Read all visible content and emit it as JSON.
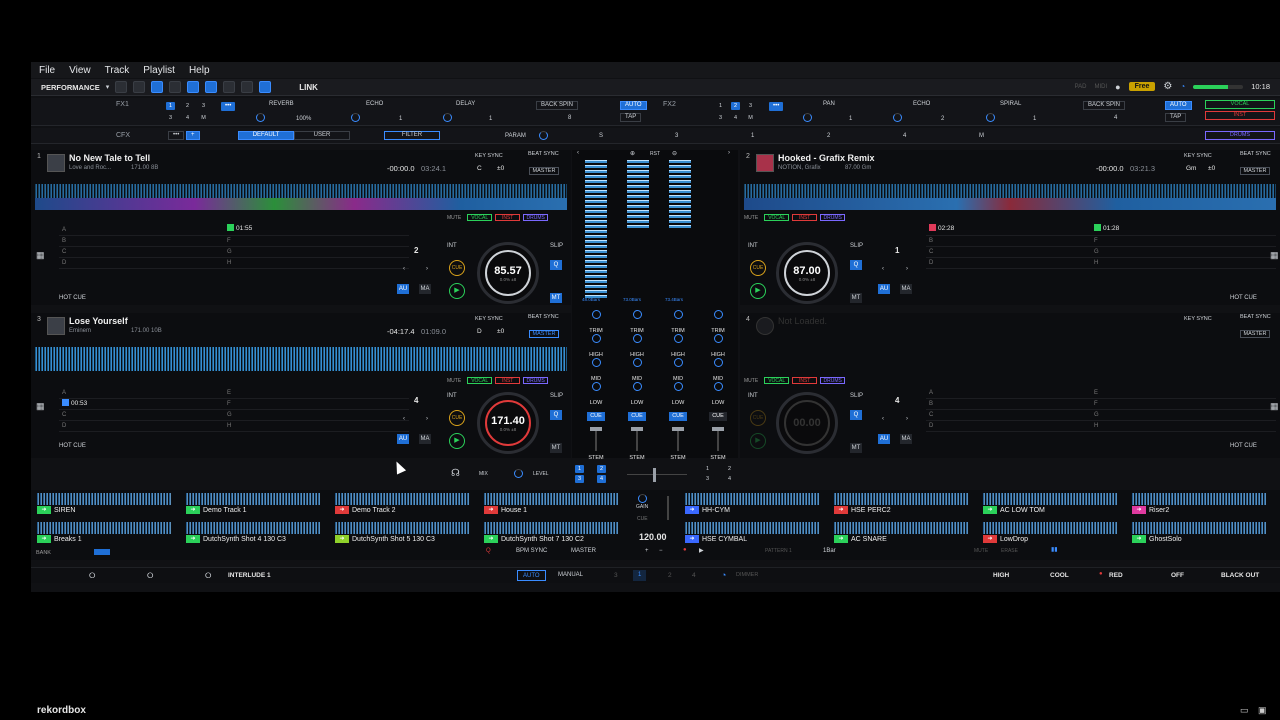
{
  "menu": [
    "File",
    "View",
    "Track",
    "Playlist",
    "Help"
  ],
  "toolbar": {
    "mode": "PERFORMANCE",
    "link": "LINK",
    "pad": "PAD",
    "midi": "MIDI",
    "plan": "Free",
    "clock": "10:18"
  },
  "fx1": {
    "label": "FX1",
    "slots": [
      "REVERB",
      "ECHO",
      "DELAY"
    ],
    "beat": "BACK SPIN",
    "auto": "AUTO",
    "tap": "TAP",
    "pct": "100%",
    "n1": "1",
    "n2": "1",
    "n3": "8"
  },
  "fx2": {
    "label": "FX2",
    "slots": [
      "PAN",
      "ECHO",
      "SPIRAL"
    ],
    "beat": "BACK SPIN",
    "auto": "AUTO",
    "tap": "TAP",
    "n1": "1",
    "n2": "2",
    "n3": "1",
    "n4": "4"
  },
  "fx_channels": [
    "1",
    "2",
    "3",
    "4",
    "M"
  ],
  "cfx": {
    "label": "CFX",
    "default": "DEFAULT",
    "user": "USER",
    "filter": "FILTER",
    "param": "PARAM",
    "s": "S",
    "nums": [
      "3",
      "1",
      "2",
      "4",
      "M"
    ]
  },
  "stem_colors": {
    "vocal": "VOCAL",
    "inst": "INST",
    "drums": "DRUMS"
  },
  "deck_labels": {
    "key_sync": "KEY SYNC",
    "beat_sync": "BEAT SYNC",
    "master": "MASTER",
    "mute": "MUTE",
    "vocal": "VOCAL",
    "inst": "INST",
    "drums": "DRUMS",
    "int": "INT",
    "slip": "SLIP",
    "q": "Q",
    "au": "AU",
    "ma": "MA",
    "mt": "MT",
    "cue": "CUE",
    "hot_cue": "HOT CUE"
  },
  "cue_letters_left": [
    "A",
    "B",
    "C",
    "D"
  ],
  "cue_letters_right": [
    "E",
    "F",
    "G",
    "H"
  ],
  "deck1": {
    "num": "1",
    "title": "No New Tale to Tell",
    "artist": "Love and Roc...",
    "bpm_key": "171.00  8B",
    "elapsed": "-00:00.0",
    "remain": "03:24.1",
    "key": "C",
    "pitch": "±0",
    "bpm": "85.57",
    "bpm_sub": "0.0%  ±8",
    "loop": "2",
    "cue1": "01:55"
  },
  "deck2": {
    "num": "2",
    "title": "Hooked - Grafix Remix",
    "artist": "NOTION, Grafix",
    "bpm_key": "87.00  Gm",
    "elapsed": "-00:00.0",
    "remain": "03:21.3",
    "key": "Gm",
    "pitch": "±0",
    "bpm": "87.00",
    "bpm_sub": "0.0%  ±8",
    "loop": "1",
    "cueA": "02:28",
    "cue2": "01:28"
  },
  "deck3": {
    "num": "3",
    "title": "Lose Yourself",
    "artist": "Eminem",
    "bpm_key": "171.00  10B",
    "elapsed": "-04:17.4",
    "remain": "01:09.0",
    "key": "D",
    "pitch": "±0",
    "bpm": "171.40",
    "bpm_sub": "0.0%  ±8",
    "loop": "4",
    "cue1": "00:53"
  },
  "deck4": {
    "num": "4",
    "title": "Not Loaded.",
    "bpm": "00.00",
    "loop": "4"
  },
  "mixer": {
    "trim": "TRIM",
    "high": "HIGH",
    "mid": "MID",
    "low": "LOW",
    "cue": "CUE",
    "stem": "STEM",
    "bars": [
      "48.0Bars",
      "73.0Bars",
      "73.4Bars"
    ],
    "rst": "RST"
  },
  "xfader": {
    "mix": "MIX",
    "level": "LEVEL",
    "nums": [
      "1",
      "2",
      "3",
      "4"
    ]
  },
  "sampler": {
    "left": [
      {
        "name": "SIREN",
        "color": "#2bd15a"
      },
      {
        "name": "Demo Track 1",
        "color": "#2bd15a"
      },
      {
        "name": "Demo Track 2",
        "color": "#e03a3a"
      },
      {
        "name": "House 1",
        "color": "#e03a3a"
      },
      {
        "name": "Breaks 1",
        "color": "#2bd15a"
      },
      {
        "name": "DutchSynth Shot 4 130 C3",
        "color": "#2bd15a"
      },
      {
        "name": "DutchSynth Shot 5 130 C3",
        "color": "#8fd12b"
      },
      {
        "name": "DutchSynth Shot 7 130 C2",
        "color": "#2bd15a"
      }
    ],
    "right": [
      {
        "name": "HH-CYM",
        "color": "#3a68ff"
      },
      {
        "name": "HSE PERC2",
        "color": "#e03a3a"
      },
      {
        "name": "AC LOW TOM",
        "color": "#2bd15a"
      },
      {
        "name": "Riser2",
        "color": "#e03aa0"
      },
      {
        "name": "HSE CYMBAL",
        "color": "#3a68ff"
      },
      {
        "name": "AC SNARE",
        "color": "#2bd15a"
      },
      {
        "name": "LowDrop",
        "color": "#e03a3a"
      },
      {
        "name": "GhostSolo",
        "color": "#2bd15a"
      }
    ],
    "bank": "BANK",
    "gain": "GAIN",
    "cue": "CUE",
    "bpm": "120.00",
    "bpm_sync": "BPM SYNC",
    "master": "MASTER",
    "pattern": "PATTERN 1",
    "bar": "1Bar",
    "mute": "MUTE",
    "erase": "ERASE"
  },
  "bottom": {
    "interlude": "INTERLUDE 1",
    "auto": "AUTO",
    "manual": "MANUAL",
    "nums": [
      "3",
      "1",
      "2",
      "4"
    ],
    "dimmer": "DIMMER",
    "high": "HIGH",
    "cool": "COOL",
    "red": "RED",
    "off": "OFF",
    "blackout": "BLACK OUT"
  },
  "brand": "rekordbox"
}
